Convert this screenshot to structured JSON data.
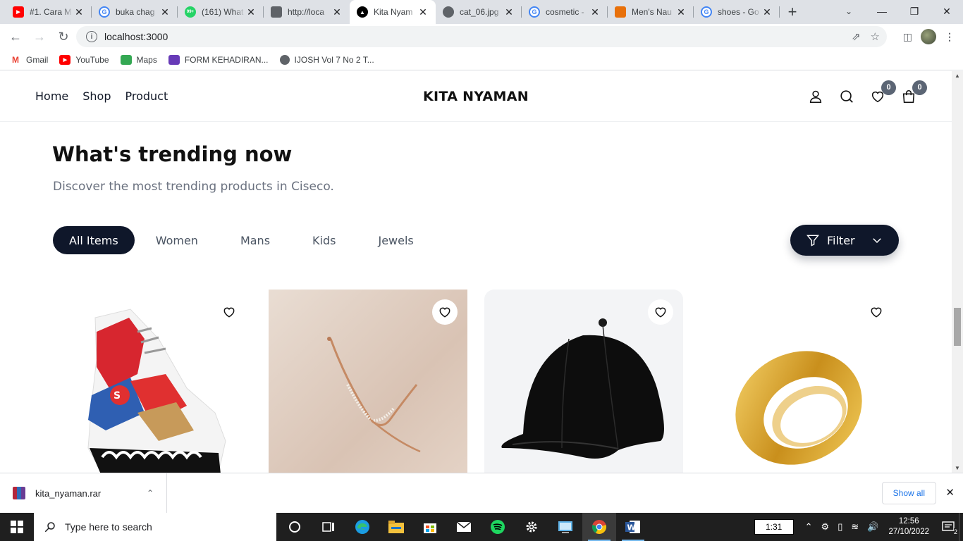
{
  "browser": {
    "tabs": [
      {
        "title": "#1. Cara M",
        "icon": "youtube-icon",
        "color": "#ff0000"
      },
      {
        "title": "buka chag",
        "icon": "google-icon",
        "color": "#4285f4"
      },
      {
        "title": "(161) What",
        "icon": "whatsapp-icon",
        "color": "#25d366"
      },
      {
        "title": "http://loca",
        "icon": "laptop-icon",
        "color": "#5f6368"
      },
      {
        "title": "Kita Nyam",
        "icon": "app-triangle-icon",
        "color": "#000000"
      },
      {
        "title": "cat_06.jpg",
        "icon": "globe-icon",
        "color": "#5f6368"
      },
      {
        "title": "cosmetic -",
        "icon": "google-icon",
        "color": "#4285f4"
      },
      {
        "title": "Men's Nau",
        "icon": "nautica-icon",
        "color": "#e8700a"
      },
      {
        "title": "shoes - Go",
        "icon": "google-icon",
        "color": "#4285f4"
      }
    ],
    "active_tab": 4,
    "url": "localhost:3000",
    "bookmarks": [
      {
        "label": "Gmail",
        "icon": "gmail-icon",
        "color": "#ea4335"
      },
      {
        "label": "YouTube",
        "icon": "youtube-icon",
        "color": "#ff0000"
      },
      {
        "label": "Maps",
        "icon": "maps-icon",
        "color": "#34a853"
      },
      {
        "label": "FORM KEHADIRAN...",
        "icon": "forms-icon",
        "color": "#673ab7"
      },
      {
        "label": "IJOSH Vol 7 No 2 T...",
        "icon": "globe-icon",
        "color": "#5f6368"
      }
    ]
  },
  "site": {
    "nav": [
      "Home",
      "Shop",
      "Product"
    ],
    "brand": "KITA NYAMAN",
    "wishlist_count": "0",
    "cart_count": "0"
  },
  "section": {
    "title": "What's trending now",
    "subtitle": "Discover the most trending products in Ciseco.",
    "filters": [
      "All Items",
      "Women",
      "Mans",
      "Kids",
      "Jewels"
    ],
    "active_filter": 0,
    "filter_button": "Filter"
  },
  "products": [
    {
      "name": "sneaker",
      "image": "shoe-image"
    },
    {
      "name": "bracelet",
      "image": "bracelet-image"
    },
    {
      "name": "cap",
      "image": "cap-image"
    },
    {
      "name": "ring",
      "image": "ring-image"
    }
  ],
  "downloads": {
    "file": "kita_nyaman.rar",
    "show_all": "Show all"
  },
  "taskbar": {
    "search_placeholder": "Type here to search",
    "timer": "1:31",
    "time": "12:56",
    "date": "27/10/2022",
    "notifications": "2"
  }
}
